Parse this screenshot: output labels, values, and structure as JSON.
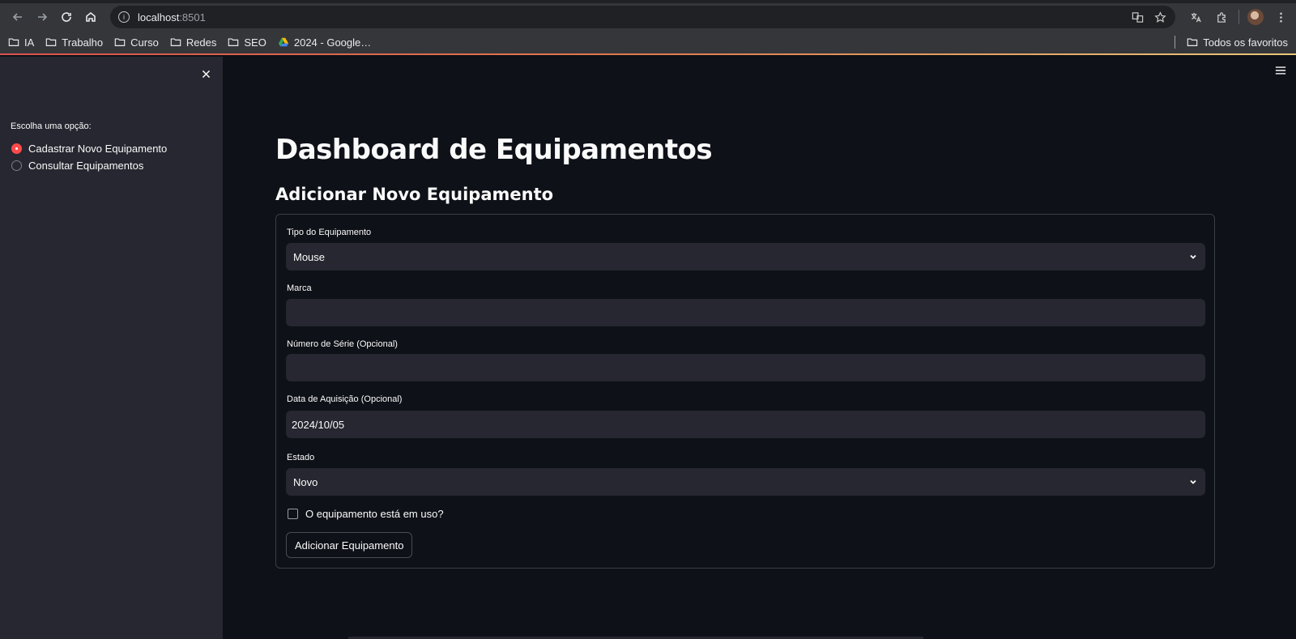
{
  "browser": {
    "url_host": "localhost",
    "url_port": ":8501",
    "bookmarks": [
      {
        "label": "IA",
        "icon": "folder-icon"
      },
      {
        "label": "Trabalho",
        "icon": "folder-icon"
      },
      {
        "label": "Curso",
        "icon": "folder-icon"
      },
      {
        "label": "Redes",
        "icon": "folder-icon"
      },
      {
        "label": "SEO",
        "icon": "folder-icon"
      },
      {
        "label": "2024 - Google…",
        "icon": "google-drive-icon"
      }
    ],
    "all_bookmarks": "Todos os favoritos"
  },
  "sidebar": {
    "radio_label": "Escolha uma opção:",
    "options": [
      {
        "label": "Cadastrar Novo Equipamento",
        "selected": true
      },
      {
        "label": "Consultar Equipamentos",
        "selected": false
      }
    ]
  },
  "main": {
    "title": "Dashboard de Equipamentos",
    "subtitle": "Adicionar Novo Equipamento",
    "form": {
      "tipo_label": "Tipo do Equipamento",
      "tipo_value": "Mouse",
      "marca_label": "Marca",
      "marca_value": "",
      "serie_label": "Número de Série (Opcional)",
      "serie_value": "",
      "data_label": "Data de Aquisição (Opcional)",
      "data_value": "2024/10/05",
      "estado_label": "Estado",
      "estado_value": "Novo",
      "em_uso_label": "O equipamento está em uso?",
      "em_uso_checked": false,
      "submit_label": "Adicionar Equipamento"
    }
  },
  "colors": {
    "accent": "#ff4b4b",
    "background": "#0e1117",
    "secondary_background": "#262730",
    "text": "#fafafa"
  }
}
